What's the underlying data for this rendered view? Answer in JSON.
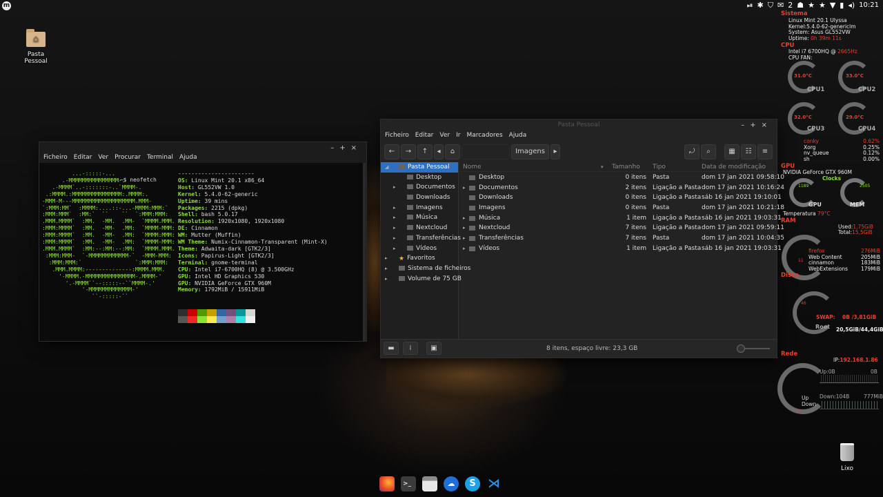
{
  "panel": {
    "time": "10:21",
    "tray_number": "2",
    "menu_glyph": "m"
  },
  "desktop": {
    "home_label": "Pasta Pessoal",
    "trash_label": "Lixo"
  },
  "terminal": {
    "menu": [
      "Ficheiro",
      "Editar",
      "Ver",
      "Procurar",
      "Terminal",
      "Ajuda"
    ],
    "prompt": ":~$ neofetch",
    "art": "         ...-:::::-...\n      .-MMMMMMMMMMMMMMM-.\n   .-MMMM`..-:::::::-..`MMMM-.\n .:MMMM.:MMMMMMMMMMMMMMM:.MMMM:.\n-MMM-M---MMMMMMMMMMMMMMMMMMM.MMM-\n`:MMM:MM`  :MMMM:....::-...-MMMM:MMM:`\n:MMM:MMM`  :MM:`  ``    ``  `:MMM:MMM:\n.MMM.MMMM`  :MM.  -MM.  .MM-  `MMMM.MMM.\n:MMM:MMMM`  :MM.  -MM-  .MM:  `MMMM-MMM:\n:MMM:MMMM`  :MM.  -MM-  .MM:  `MMMM:MMM:\n:MMM:MMMM`  :MM.  -MM-  .MM:  `MMMM-MMM:\n.MMM.MMMM`  :MM:--:MM:--:MM:  `MMMM.MMM.\n :MMM:MMM-  `-MMMMMMMMMMMM-`  -MMM-MMM:\n  :MMM:MMM:`                `:MMM:MMM:\n   .MMM.MMMM:--------------:MMMM.MMM.\n     '-MMMM.-MMMMMMMMMMMMMMM-.MMMM-'\n       '.-MMMM``--:::::--``MMMM-.'\n            '-MMMMMMMMMMMMM-'\n               ``-:::::-``",
    "info": [
      {
        "k": "",
        "v": "-----------------------"
      },
      {
        "k": "OS:",
        "v": " Linux Mint 20.1 x86_64"
      },
      {
        "k": "Host:",
        "v": " GL552VW 1.0"
      },
      {
        "k": "Kernel:",
        "v": " 5.4.0-62-generic"
      },
      {
        "k": "Uptime:",
        "v": " 39 mins"
      },
      {
        "k": "Packages:",
        "v": " 2215 (dpkg)"
      },
      {
        "k": "Shell:",
        "v": " bash 5.0.17"
      },
      {
        "k": "Resolution:",
        "v": " 1920x1080, 1920x1080"
      },
      {
        "k": "DE:",
        "v": " Cinnamon"
      },
      {
        "k": "WM:",
        "v": " Mutter (Muffin)"
      },
      {
        "k": "WM Theme:",
        "v": " Numix-Cinnamon-Transparent (Mint-X)"
      },
      {
        "k": "Theme:",
        "v": " Adwaita-dark [GTK2/3]"
      },
      {
        "k": "Icons:",
        "v": " Papirus-Light [GTK2/3]"
      },
      {
        "k": "Terminal:",
        "v": " gnome-terminal"
      },
      {
        "k": "CPU:",
        "v": " Intel i7-6700HQ (8) @ 3.500GHz"
      },
      {
        "k": "GPU:",
        "v": " Intel HD Graphics 530"
      },
      {
        "k": "GPU:",
        "v": " NVIDIA GeForce GTX 960M"
      },
      {
        "k": "Memory:",
        "v": " 1792MiB / 15911MiB"
      }
    ],
    "swatch_colors": [
      "#2e2e2e",
      "#cc0000",
      "#4e9a06",
      "#c4a000",
      "#3465a4",
      "#75507b",
      "#06989a",
      "#d3d7cf",
      "#555753",
      "#ef2929",
      "#8ae234",
      "#fce94f",
      "#729fcf",
      "#ad7fa8",
      "#34e2e2",
      "#eeeeec"
    ]
  },
  "files": {
    "title": "Pasta Pessoal",
    "menu": [
      "Ficheiro",
      "Editar",
      "Ver",
      "Ir",
      "Marcadores",
      "Ajuda"
    ],
    "breadcrumb": "Imagens",
    "sidebar": [
      {
        "label": "Pasta Pessoal",
        "sel": true,
        "arrow": "◢",
        "indent": 0
      },
      {
        "label": "Desktop",
        "indent": 1
      },
      {
        "label": "Documentos",
        "indent": 1,
        "arrow": "▸"
      },
      {
        "label": "Downloads",
        "indent": 1
      },
      {
        "label": "Imagens",
        "indent": 1,
        "arrow": "▸"
      },
      {
        "label": "Música",
        "indent": 1,
        "arrow": "▸"
      },
      {
        "label": "Nextcloud",
        "indent": 1,
        "arrow": "▸"
      },
      {
        "label": "Transferências",
        "indent": 1,
        "arrow": "▸"
      },
      {
        "label": "Vídeos",
        "indent": 1,
        "arrow": "▸"
      },
      {
        "label": "Favoritos",
        "indent": 0,
        "arrow": "▸",
        "star": true
      },
      {
        "label": "Sistema de ficheiros",
        "indent": 0,
        "arrow": "▸"
      },
      {
        "label": "Volume de 75 GB",
        "indent": 0,
        "arrow": "▸"
      }
    ],
    "columns": [
      "Nome",
      "Tamanho",
      "Tipo",
      "Data de modificação"
    ],
    "rows": [
      {
        "name": "Desktop",
        "size": "0 itens",
        "type": "Pasta",
        "date": "dom 17 jan 2021 09:58:10",
        "arrow": ""
      },
      {
        "name": "Documentos",
        "size": "2 itens",
        "type": "Ligação a Pasta",
        "date": "dom 17 jan 2021 10:16:24",
        "arrow": "▸"
      },
      {
        "name": "Downloads",
        "size": "0 itens",
        "type": "Ligação a Pasta",
        "date": "sáb 16 jan 2021 19:10:01",
        "arrow": ""
      },
      {
        "name": "Imagens",
        "size": "0 itens",
        "type": "Pasta",
        "date": "dom 17 jan 2021 10:21:18",
        "arrow": ""
      },
      {
        "name": "Música",
        "size": "1 item",
        "type": "Ligação a Pasta",
        "date": "sáb 16 jan 2021 19:03:31",
        "arrow": "▸"
      },
      {
        "name": "Nextcloud",
        "size": "7 itens",
        "type": "Ligação a Pasta",
        "date": "dom 17 jan 2021 09:59:11",
        "arrow": "▸"
      },
      {
        "name": "Transferências",
        "size": "7 itens",
        "type": "Pasta",
        "date": "dom 17 jan 2021 10:04:35",
        "arrow": "▸"
      },
      {
        "name": "Vídeos",
        "size": "1 item",
        "type": "Ligação a Pasta",
        "date": "sáb 16 jan 2021 19:03:31",
        "arrow": "▸"
      }
    ],
    "status": "8 itens, espaço livre: 23,3 GB"
  },
  "conky": {
    "sys_title": "Sistema",
    "sys_lines": [
      "Linux Mint 20.1 Ulyssa",
      "Kernel:5.4.0-62-genericlm",
      "System: Asus GL552VW"
    ],
    "uptime_label": "Uptime: ",
    "uptime_value": "0h 39m 11s",
    "cpu_title": "CPU",
    "cpu_model": "Intel i7 6700HQ @ ",
    "cpu_freq": "2665Hz",
    "cpu_fan": "CPU FAN:",
    "cpus": [
      {
        "label": "CPU1",
        "temp": "31.0°C"
      },
      {
        "label": "CPU2",
        "temp": "33.0°C"
      },
      {
        "label": "CPU3",
        "temp": "32.0°C"
      },
      {
        "label": "CPU4",
        "temp": "29.0°C"
      }
    ],
    "procs": [
      {
        "n": "conky",
        "v": "0.62%"
      },
      {
        "n": "Xorg",
        "v": "0.25%"
      },
      {
        "n": "nv_queue",
        "v": "0.12%"
      },
      {
        "n": "sh",
        "v": "0.00%"
      }
    ],
    "gpu_title": "GPU",
    "gpu_model": "NVIDIA GeForce GTX 960M",
    "clocks": "Clocks",
    "gpu_clock": "1189",
    "mem_clock": "2505",
    "gpu_label": "GPU",
    "mem_label": "MEM",
    "temp_label": "Temperatura ",
    "temp_value": "79°C",
    "ram_title": "RAM",
    "used_label": "Used:",
    "used_value": "1,75GiB",
    "total_label": "Total:",
    "total_value": "15,5GiB",
    "ram_pct": "11",
    "ram_procs": [
      {
        "n": "firefox",
        "v": "276MiB"
      },
      {
        "n": "Web Content",
        "v": "205MiB"
      },
      {
        "n": "cinnamon",
        "v": "183MiB"
      },
      {
        "n": "WebExtensions",
        "v": "179MiB"
      }
    ],
    "disk_title": "Disco",
    "disk_pct": "46",
    "swap_label": "SWAP:",
    "swap_value": "0B  /3,81GiB",
    "root_label": "Root",
    "root_value": "20,5GiB/44,4GiB",
    "net_title": "Rede",
    "ip_label": "IP:",
    "ip_value": "192.168.1.86",
    "up_label": "Up:0B",
    "up_total": "0B",
    "down_label": "Down:104B",
    "down_total": "777MiB",
    "updown_up": "Up",
    "updown_down": "Down",
    "net_tick": "0.1"
  },
  "dock": [
    "firefox-icon",
    "terminal-icon",
    "files-icon",
    "nextcloud-icon",
    "skype-icon",
    "vscode-icon"
  ]
}
